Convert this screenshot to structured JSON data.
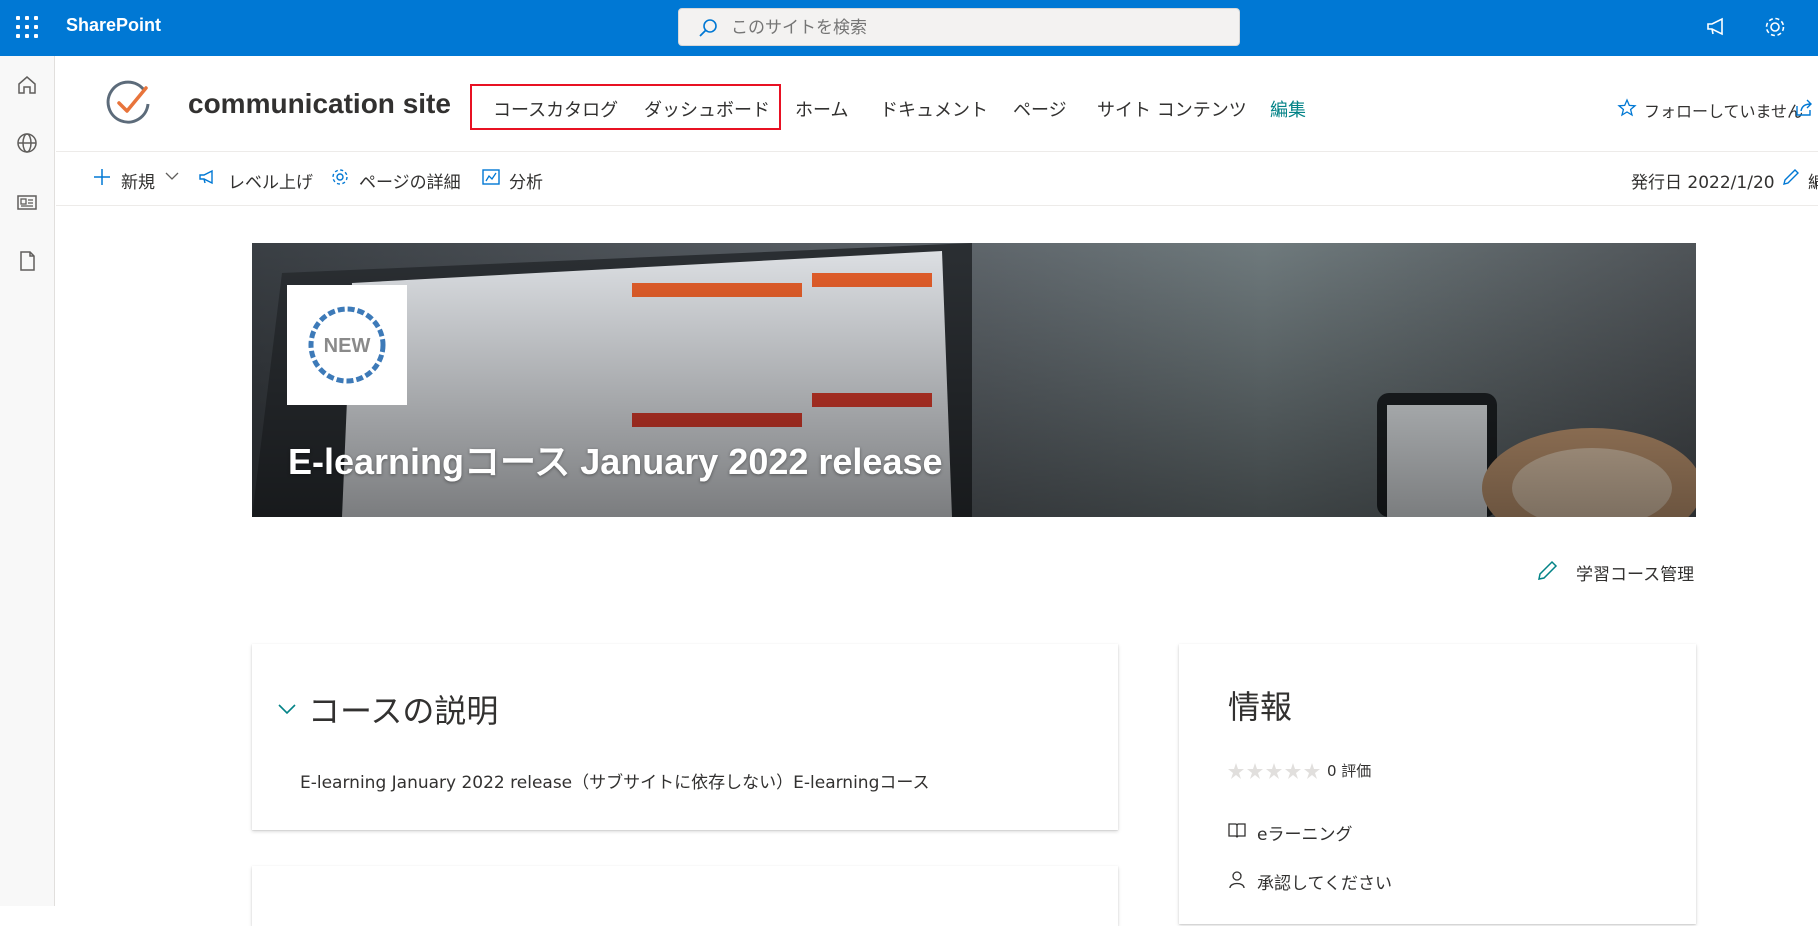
{
  "suitebar": {
    "app_name": "SharePoint",
    "search_placeholder": "このサイトを検索",
    "color": "#0078d4"
  },
  "left_rail": {
    "icons": [
      "home-icon",
      "globe-icon",
      "news-icon",
      "document-icon"
    ]
  },
  "header": {
    "site_title": "communication site",
    "nav": {
      "course_catalog": "コースカタログ",
      "dashboard": "ダッシュボード",
      "home": "ホーム",
      "documents": "ドキュメント",
      "pages": "ページ",
      "site_contents": "サイト コンテンツ",
      "edit": "編集"
    },
    "follow_label": "フォローしていません"
  },
  "command_bar": {
    "new_label": "新規",
    "promote_label": "レベル上げ",
    "page_details_label": "ページの詳細",
    "analytics_label": "分析",
    "published_label": "発行日 2022/1/20",
    "edit_label": "編"
  },
  "hero": {
    "badge_text": "NEW",
    "title": "E-learningコース January 2022 release"
  },
  "manage_link": "学習コース管理",
  "description_card": {
    "title": "コースの説明",
    "text": "E-learning January 2022 release（サブサイトに依存しない）E-learningコース"
  },
  "info_card": {
    "title": "情報",
    "rating_stars": 0,
    "rating_text": "0 評価",
    "type_label": "eラーニング",
    "approval_label": "承認してください"
  },
  "colors": {
    "accent": "#0078d4",
    "teal": "#038387",
    "highlight_box": "#e81123"
  }
}
